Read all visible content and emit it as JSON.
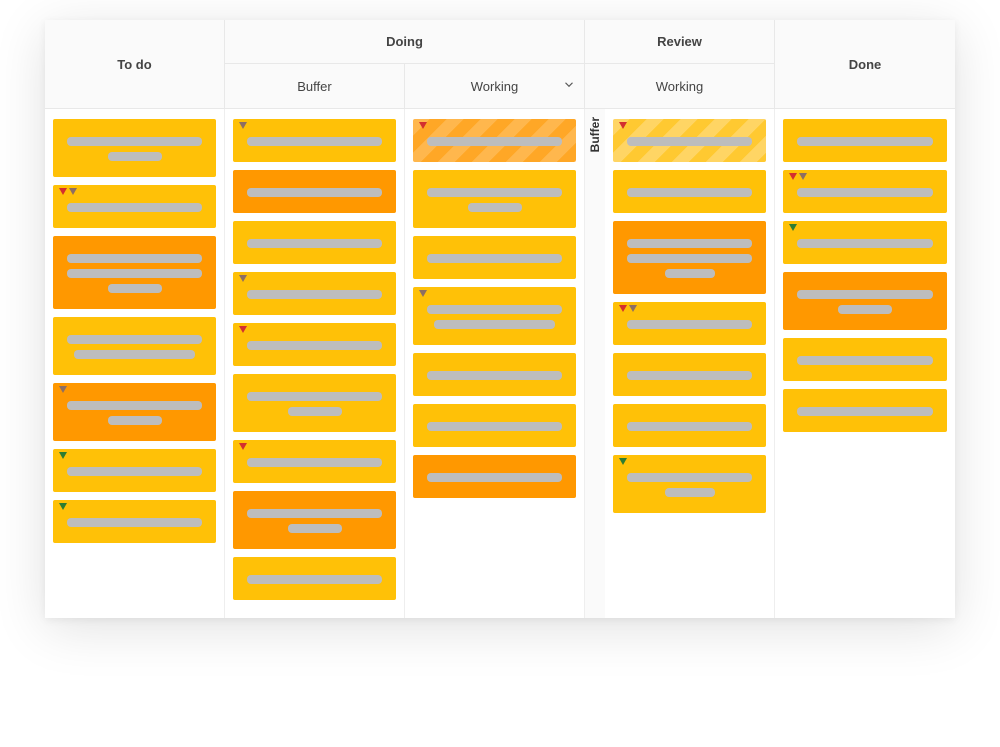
{
  "header": {
    "todo": "To do",
    "doing": "Doing",
    "doing_sub": [
      "Buffer",
      "Working"
    ],
    "review": "Review",
    "review_sub": [
      "Working"
    ],
    "done": "Done",
    "collapsed_label": "Buffer"
  },
  "columns": {
    "todo": [
      {
        "color": "yellow",
        "lines": [
          "long",
          "short"
        ],
        "pins": []
      },
      {
        "color": "yellow",
        "lines": [
          "long"
        ],
        "pins": [
          "red",
          "brown"
        ]
      },
      {
        "color": "orange",
        "lines": [
          "long",
          "long",
          "short"
        ],
        "pins": []
      },
      {
        "color": "yellow",
        "lines": [
          "long",
          "med"
        ],
        "pins": []
      },
      {
        "color": "orange",
        "lines": [
          "long",
          "short"
        ],
        "pins": [
          "brown"
        ]
      },
      {
        "color": "yellow",
        "lines": [
          "long"
        ],
        "pins": [
          "green"
        ]
      },
      {
        "color": "yellow",
        "lines": [
          "long"
        ],
        "pins": [
          "green"
        ]
      }
    ],
    "buffer": [
      {
        "color": "yellow",
        "lines": [
          "long"
        ],
        "pins": [
          "brown"
        ]
      },
      {
        "color": "orange",
        "lines": [
          "long"
        ],
        "pins": []
      },
      {
        "color": "yellow",
        "lines": [
          "long"
        ],
        "pins": []
      },
      {
        "color": "yellow",
        "lines": [
          "long"
        ],
        "pins": [
          "brown"
        ]
      },
      {
        "color": "yellow",
        "lines": [
          "long"
        ],
        "pins": [
          "red"
        ]
      },
      {
        "color": "yellow",
        "lines": [
          "long",
          "short"
        ],
        "pins": []
      },
      {
        "color": "yellow",
        "lines": [
          "long"
        ],
        "pins": [
          "red"
        ]
      },
      {
        "color": "orange",
        "lines": [
          "long",
          "short"
        ],
        "pins": []
      },
      {
        "color": "yellow",
        "lines": [
          "long"
        ],
        "pins": []
      }
    ],
    "working": [
      {
        "color": "striped",
        "lines": [
          "long"
        ],
        "pins": [
          "red"
        ]
      },
      {
        "color": "yellow",
        "lines": [
          "long",
          "short"
        ],
        "pins": []
      },
      {
        "color": "yellow",
        "lines": [
          "long"
        ],
        "pins": []
      },
      {
        "color": "yellow",
        "lines": [
          "long",
          "med"
        ],
        "pins": [
          "brown"
        ]
      },
      {
        "color": "yellow",
        "lines": [
          "long"
        ],
        "pins": []
      },
      {
        "color": "yellow",
        "lines": [
          "long"
        ],
        "pins": []
      },
      {
        "color": "orange",
        "lines": [
          "long"
        ],
        "pins": []
      }
    ],
    "review": [
      {
        "color": "stripedLight",
        "lines": [
          "long"
        ],
        "pins": [
          "red"
        ]
      },
      {
        "color": "yellow",
        "lines": [
          "long"
        ],
        "pins": []
      },
      {
        "color": "orange",
        "lines": [
          "long",
          "long",
          "short"
        ],
        "pins": []
      },
      {
        "color": "yellow",
        "lines": [
          "long"
        ],
        "pins": [
          "red",
          "brown"
        ]
      },
      {
        "color": "yellow",
        "lines": [
          "long"
        ],
        "pins": []
      },
      {
        "color": "yellow",
        "lines": [
          "long"
        ],
        "pins": []
      },
      {
        "color": "yellow",
        "lines": [
          "long",
          "short"
        ],
        "pins": [
          "green"
        ]
      }
    ],
    "done": [
      {
        "color": "yellow",
        "lines": [
          "long"
        ],
        "pins": []
      },
      {
        "color": "yellow",
        "lines": [
          "long"
        ],
        "pins": [
          "red",
          "brown"
        ]
      },
      {
        "color": "yellow",
        "lines": [
          "long"
        ],
        "pins": [
          "green"
        ]
      },
      {
        "color": "orange",
        "lines": [
          "long",
          "short"
        ],
        "pins": []
      },
      {
        "color": "yellow",
        "lines": [
          "long"
        ],
        "pins": []
      },
      {
        "color": "yellow",
        "lines": [
          "long"
        ],
        "pins": []
      }
    ]
  }
}
